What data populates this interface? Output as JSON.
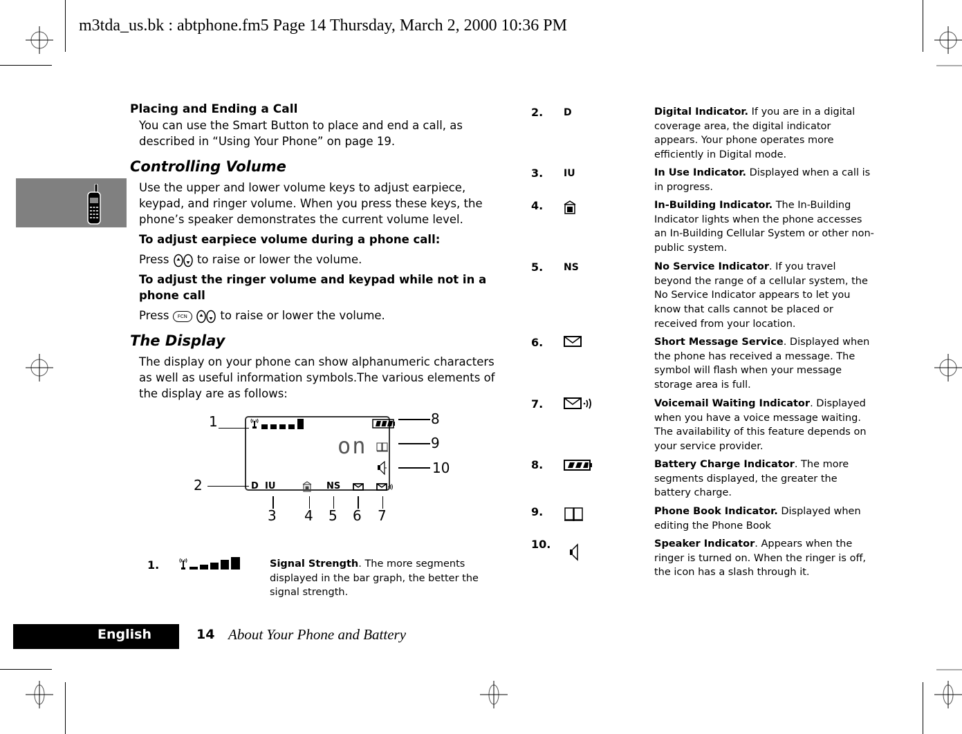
{
  "header": {
    "print_info": "m3tda_us.bk : abtphone.fm5  Page 14  Thursday, March 2, 2000  10:36 PM"
  },
  "side_tab": {
    "icon": "cellphone-icon"
  },
  "left_column": {
    "placing_heading": "Placing and Ending a Call",
    "placing_text": "You can use the Smart Button to place and end a call, as described in “Using Your Phone” on page 19.",
    "volume_heading": "Controlling Volume",
    "volume_text": "Use the upper and lower volume keys to adjust earpiece, keypad, and ringer volume. When you press these keys, the phone’s speaker demonstrates the current volume level.",
    "earpiece_heading": "To adjust earpiece volume during a phone call:",
    "earpiece_press": "Press",
    "earpiece_rest": "to raise or lower the volume.",
    "ringer_heading": "To adjust the ringer volume and keypad while not in a phone call",
    "ringer_press": "Press",
    "ringer_rest": "to raise or lower the volume.",
    "fcn_key_label": "FCN",
    "display_heading": "The Display",
    "display_text": "The display on your phone can show alphanumeric characters as well as useful information symbols.The various elements of the display are as follows:"
  },
  "lcd_diagram": {
    "screen_text": "on",
    "bottom_labels": {
      "digital": "D",
      "in_use": "IU",
      "no_service": "NS"
    },
    "callouts": [
      "1",
      "2",
      "3",
      "4",
      "5",
      "6",
      "7",
      "8",
      "9",
      "10"
    ],
    "signal_bars": 5,
    "battery_segments": 3
  },
  "items": [
    {
      "num": "1.",
      "symbol": "",
      "icon": "signal-strength-icon",
      "title": "Signal Strength",
      "title_suffix": ".",
      "text": " The more segments displayed in the bar graph, the better the signal strength."
    },
    {
      "num": "2.",
      "symbol": "D",
      "icon": "",
      "title": "Digital Indicator.",
      "title_suffix": "",
      "text": " If you are in a digital coverage area, the digital indicator appears. Your phone operates more efficiently in Digital mode."
    },
    {
      "num": "3.",
      "symbol": "IU",
      "icon": "",
      "title": "In Use Indicator.",
      "title_suffix": "",
      "text": " Displayed when a call is in progress."
    },
    {
      "num": "4.",
      "symbol": "",
      "icon": "in-building-icon",
      "title": "In-Building Indicator.",
      "title_suffix": "",
      "text": " The In-Building Indicator lights when the phone accesses an In-Building Cellular System or other non-public system."
    },
    {
      "num": "5.",
      "symbol": "NS",
      "icon": "",
      "title": "No Service Indicator",
      "title_suffix": ".",
      "text": " If you travel beyond the range of a cellular system, the No Service Indicator appears to let you know that calls cannot be placed or received from your location."
    },
    {
      "num": "6.",
      "symbol": "",
      "icon": "envelope-icon",
      "title": "Short Message Service",
      "title_suffix": ".",
      "text": " Displayed when the phone has received a message. The symbol will flash when your message storage area is full."
    },
    {
      "num": "7.",
      "symbol": "",
      "icon": "voicemail-icon",
      "title": "Voicemail Waiting Indicator",
      "title_suffix": ".",
      "text": " Displayed when you have a voice message waiting. The availability of this feature depends on your service provider."
    },
    {
      "num": "8.",
      "symbol": "",
      "icon": "battery-icon",
      "title": "Battery Charge Indicator",
      "title_suffix": ".",
      "text": " The more segments displayed, the greater the battery charge."
    },
    {
      "num": "9.",
      "symbol": "",
      "icon": "phone-book-icon",
      "title": "Phone Book Indicator.",
      "title_suffix": "",
      "text": " Displayed when editing the Phone Book"
    },
    {
      "num": "10.",
      "symbol": "",
      "icon": "speaker-icon",
      "title": "Speaker Indicator",
      "title_suffix": ".",
      "text": " Appears when the ringer is turned on. When the ringer is off, the icon has a slash through it."
    }
  ],
  "footer": {
    "language": "English",
    "page_number": "14",
    "chapter_title": "About Your Phone and Battery"
  }
}
